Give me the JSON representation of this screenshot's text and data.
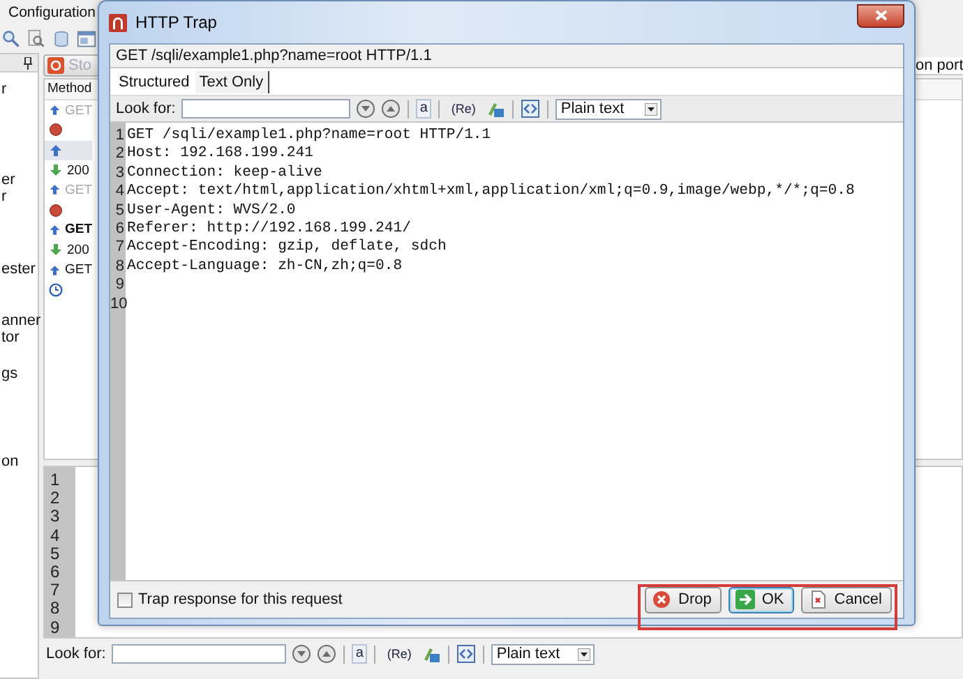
{
  "background_app": {
    "title": "Configuration",
    "toolbar_icons": [
      {
        "kind": "search"
      },
      {
        "kind": "zoom"
      },
      {
        "kind": "database"
      },
      {
        "kind": "window"
      }
    ],
    "sidebar_items": [
      {
        "label": "r"
      },
      {
        "label": "er"
      },
      {
        "label": "r"
      },
      {
        "label": "ester"
      },
      {
        "label": "anner"
      },
      {
        "label": "tor"
      },
      {
        "label": "gs"
      },
      {
        "label": "on"
      }
    ],
    "stop_button": "Sto",
    "listening_text": "on port",
    "method_column": "Method",
    "requests": [
      {
        "kind": "request",
        "method": "GET",
        "greyed": true,
        "bold": false,
        "selected": false
      },
      {
        "kind": "error",
        "selected": false
      },
      {
        "kind": "request",
        "selected": true
      },
      {
        "kind": "response",
        "method": "200",
        "greyed": false,
        "bold": false,
        "selected": false
      },
      {
        "kind": "request",
        "method": "GET",
        "greyed": true,
        "bold": false,
        "selected": false
      },
      {
        "kind": "error",
        "selected": false
      },
      {
        "kind": "request",
        "method": "GET",
        "greyed": false,
        "bold": true,
        "selected": false
      },
      {
        "kind": "response",
        "method": "200",
        "greyed": false,
        "bold": false,
        "selected": false
      },
      {
        "kind": "request",
        "method": "GET",
        "greyed": false,
        "bold": false,
        "selected": false
      },
      {
        "kind": "pending",
        "selected": false
      }
    ],
    "line_numbers": [
      "1",
      "2",
      "3",
      "4",
      "5",
      "6",
      "7",
      "8",
      "9"
    ],
    "find_bar": {
      "label": "Look for:",
      "tools": [
        {
          "kind": "find-next"
        },
        {
          "kind": "find-prev"
        },
        {
          "kind": "match-case",
          "text": "a"
        },
        {
          "kind": "regex",
          "text": "(Re)"
        },
        {
          "kind": "highlight"
        },
        {
          "kind": "code"
        }
      ],
      "format": "Plain text"
    }
  },
  "dialog": {
    "title": "HTTP Trap",
    "request_line": "GET /sqli/example1.php?name=root HTTP/1.1",
    "tabs": [
      {
        "label": "Structured",
        "selected": false
      },
      {
        "label": "Text Only",
        "selected": true
      }
    ],
    "find_bar": {
      "label": "Look for:",
      "tools": [
        {
          "kind": "find-next"
        },
        {
          "kind": "find-prev"
        },
        {
          "kind": "match-case",
          "text": "a"
        },
        {
          "kind": "regex",
          "text": "(Re)"
        },
        {
          "kind": "highlight"
        },
        {
          "kind": "code"
        }
      ],
      "format": "Plain text"
    },
    "lines": [
      {
        "number": "1",
        "text": "GET /sqli/example1.php?name=root HTTP/1.1"
      },
      {
        "number": "2",
        "text": "Host: 192.168.199.241"
      },
      {
        "number": "3",
        "text": "Connection: keep-alive"
      },
      {
        "number": "4",
        "text": "Accept: text/html,application/xhtml+xml,application/xml;q=0.9,image/webp,*/*;q=0.8"
      },
      {
        "number": "5",
        "text": "User-Agent: WVS/2.0"
      },
      {
        "number": "6",
        "text": "Referer: http://192.168.199.241/"
      },
      {
        "number": "7",
        "text": "Accept-Encoding: gzip, deflate, sdch"
      },
      {
        "number": "8",
        "text": "Accept-Language: zh-CN,zh;q=0.8"
      },
      {
        "number": "9"
      },
      {
        "number": "10"
      }
    ],
    "response_checkbox": {
      "label": "Trap response for this request",
      "checked": false
    },
    "buttons": [
      {
        "kind": "drop",
        "label": "Drop",
        "default": false
      },
      {
        "kind": "ok",
        "label": "OK",
        "default": true
      },
      {
        "kind": "cancel",
        "label": "Cancel",
        "default": false
      }
    ],
    "highlight_frame": true
  }
}
